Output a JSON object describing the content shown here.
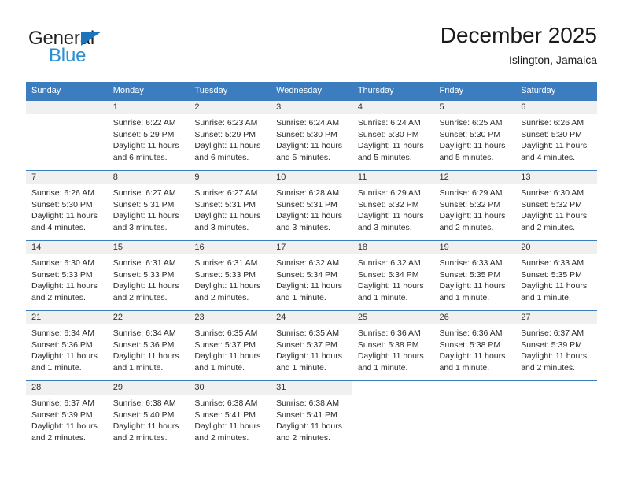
{
  "brand": {
    "name_top": "General",
    "name_bottom": "Blue"
  },
  "header": {
    "title": "December 2025",
    "subtitle": "Islington, Jamaica"
  },
  "colors": {
    "header_blue": "#3b7dbf",
    "brand_blue": "#2a8fd4",
    "triangle_blue": "#1b75bc",
    "day_band_gray": "#f0f0f0"
  },
  "weekdays": [
    "Sunday",
    "Monday",
    "Tuesday",
    "Wednesday",
    "Thursday",
    "Friday",
    "Saturday"
  ],
  "labels": {
    "sunrise_prefix": "Sunrise: ",
    "sunset_prefix": "Sunset: ",
    "daylight_prefix": "Daylight: "
  },
  "weeks": [
    [
      {
        "day": "",
        "empty": true
      },
      {
        "day": "1",
        "sunrise": "Sunrise: 6:22 AM",
        "sunset": "Sunset: 5:29 PM",
        "daylight1": "Daylight: 11 hours",
        "daylight2": "and 6 minutes."
      },
      {
        "day": "2",
        "sunrise": "Sunrise: 6:23 AM",
        "sunset": "Sunset: 5:29 PM",
        "daylight1": "Daylight: 11 hours",
        "daylight2": "and 6 minutes."
      },
      {
        "day": "3",
        "sunrise": "Sunrise: 6:24 AM",
        "sunset": "Sunset: 5:30 PM",
        "daylight1": "Daylight: 11 hours",
        "daylight2": "and 5 minutes."
      },
      {
        "day": "4",
        "sunrise": "Sunrise: 6:24 AM",
        "sunset": "Sunset: 5:30 PM",
        "daylight1": "Daylight: 11 hours",
        "daylight2": "and 5 minutes."
      },
      {
        "day": "5",
        "sunrise": "Sunrise: 6:25 AM",
        "sunset": "Sunset: 5:30 PM",
        "daylight1": "Daylight: 11 hours",
        "daylight2": "and 5 minutes."
      },
      {
        "day": "6",
        "sunrise": "Sunrise: 6:26 AM",
        "sunset": "Sunset: 5:30 PM",
        "daylight1": "Daylight: 11 hours",
        "daylight2": "and 4 minutes."
      }
    ],
    [
      {
        "day": "7",
        "sunrise": "Sunrise: 6:26 AM",
        "sunset": "Sunset: 5:30 PM",
        "daylight1": "Daylight: 11 hours",
        "daylight2": "and 4 minutes."
      },
      {
        "day": "8",
        "sunrise": "Sunrise: 6:27 AM",
        "sunset": "Sunset: 5:31 PM",
        "daylight1": "Daylight: 11 hours",
        "daylight2": "and 3 minutes."
      },
      {
        "day": "9",
        "sunrise": "Sunrise: 6:27 AM",
        "sunset": "Sunset: 5:31 PM",
        "daylight1": "Daylight: 11 hours",
        "daylight2": "and 3 minutes."
      },
      {
        "day": "10",
        "sunrise": "Sunrise: 6:28 AM",
        "sunset": "Sunset: 5:31 PM",
        "daylight1": "Daylight: 11 hours",
        "daylight2": "and 3 minutes."
      },
      {
        "day": "11",
        "sunrise": "Sunrise: 6:29 AM",
        "sunset": "Sunset: 5:32 PM",
        "daylight1": "Daylight: 11 hours",
        "daylight2": "and 3 minutes."
      },
      {
        "day": "12",
        "sunrise": "Sunrise: 6:29 AM",
        "sunset": "Sunset: 5:32 PM",
        "daylight1": "Daylight: 11 hours",
        "daylight2": "and 2 minutes."
      },
      {
        "day": "13",
        "sunrise": "Sunrise: 6:30 AM",
        "sunset": "Sunset: 5:32 PM",
        "daylight1": "Daylight: 11 hours",
        "daylight2": "and 2 minutes."
      }
    ],
    [
      {
        "day": "14",
        "sunrise": "Sunrise: 6:30 AM",
        "sunset": "Sunset: 5:33 PM",
        "daylight1": "Daylight: 11 hours",
        "daylight2": "and 2 minutes."
      },
      {
        "day": "15",
        "sunrise": "Sunrise: 6:31 AM",
        "sunset": "Sunset: 5:33 PM",
        "daylight1": "Daylight: 11 hours",
        "daylight2": "and 2 minutes."
      },
      {
        "day": "16",
        "sunrise": "Sunrise: 6:31 AM",
        "sunset": "Sunset: 5:33 PM",
        "daylight1": "Daylight: 11 hours",
        "daylight2": "and 2 minutes."
      },
      {
        "day": "17",
        "sunrise": "Sunrise: 6:32 AM",
        "sunset": "Sunset: 5:34 PM",
        "daylight1": "Daylight: 11 hours",
        "daylight2": "and 1 minute."
      },
      {
        "day": "18",
        "sunrise": "Sunrise: 6:32 AM",
        "sunset": "Sunset: 5:34 PM",
        "daylight1": "Daylight: 11 hours",
        "daylight2": "and 1 minute."
      },
      {
        "day": "19",
        "sunrise": "Sunrise: 6:33 AM",
        "sunset": "Sunset: 5:35 PM",
        "daylight1": "Daylight: 11 hours",
        "daylight2": "and 1 minute."
      },
      {
        "day": "20",
        "sunrise": "Sunrise: 6:33 AM",
        "sunset": "Sunset: 5:35 PM",
        "daylight1": "Daylight: 11 hours",
        "daylight2": "and 1 minute."
      }
    ],
    [
      {
        "day": "21",
        "sunrise": "Sunrise: 6:34 AM",
        "sunset": "Sunset: 5:36 PM",
        "daylight1": "Daylight: 11 hours",
        "daylight2": "and 1 minute."
      },
      {
        "day": "22",
        "sunrise": "Sunrise: 6:34 AM",
        "sunset": "Sunset: 5:36 PM",
        "daylight1": "Daylight: 11 hours",
        "daylight2": "and 1 minute."
      },
      {
        "day": "23",
        "sunrise": "Sunrise: 6:35 AM",
        "sunset": "Sunset: 5:37 PM",
        "daylight1": "Daylight: 11 hours",
        "daylight2": "and 1 minute."
      },
      {
        "day": "24",
        "sunrise": "Sunrise: 6:35 AM",
        "sunset": "Sunset: 5:37 PM",
        "daylight1": "Daylight: 11 hours",
        "daylight2": "and 1 minute."
      },
      {
        "day": "25",
        "sunrise": "Sunrise: 6:36 AM",
        "sunset": "Sunset: 5:38 PM",
        "daylight1": "Daylight: 11 hours",
        "daylight2": "and 1 minute."
      },
      {
        "day": "26",
        "sunrise": "Sunrise: 6:36 AM",
        "sunset": "Sunset: 5:38 PM",
        "daylight1": "Daylight: 11 hours",
        "daylight2": "and 1 minute."
      },
      {
        "day": "27",
        "sunrise": "Sunrise: 6:37 AM",
        "sunset": "Sunset: 5:39 PM",
        "daylight1": "Daylight: 11 hours",
        "daylight2": "and 2 minutes."
      }
    ],
    [
      {
        "day": "28",
        "sunrise": "Sunrise: 6:37 AM",
        "sunset": "Sunset: 5:39 PM",
        "daylight1": "Daylight: 11 hours",
        "daylight2": "and 2 minutes."
      },
      {
        "day": "29",
        "sunrise": "Sunrise: 6:38 AM",
        "sunset": "Sunset: 5:40 PM",
        "daylight1": "Daylight: 11 hours",
        "daylight2": "and 2 minutes."
      },
      {
        "day": "30",
        "sunrise": "Sunrise: 6:38 AM",
        "sunset": "Sunset: 5:41 PM",
        "daylight1": "Daylight: 11 hours",
        "daylight2": "and 2 minutes."
      },
      {
        "day": "31",
        "sunrise": "Sunrise: 6:38 AM",
        "sunset": "Sunset: 5:41 PM",
        "daylight1": "Daylight: 11 hours",
        "daylight2": "and 2 minutes."
      },
      {
        "day": "",
        "blank": true
      },
      {
        "day": "",
        "blank": true
      },
      {
        "day": "",
        "blank": true
      }
    ]
  ]
}
